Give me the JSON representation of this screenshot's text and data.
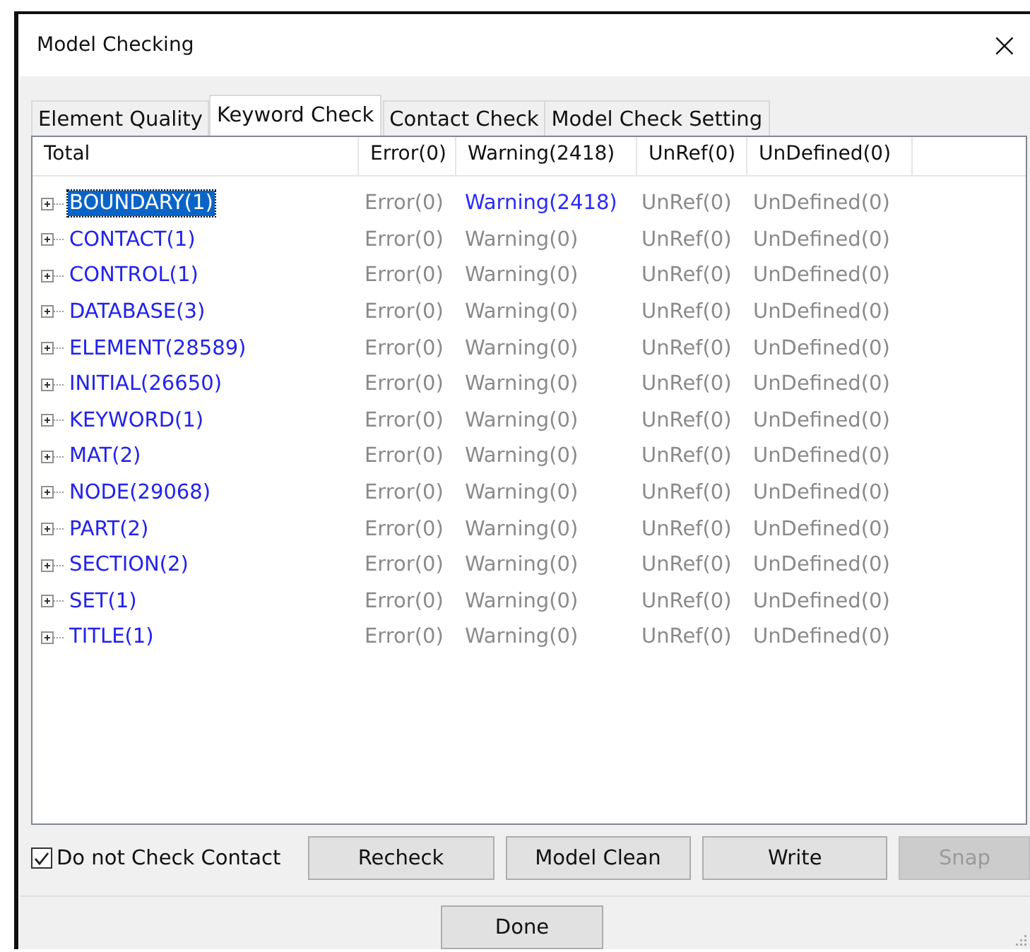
{
  "window": {
    "title": "Model Checking",
    "close": "×"
  },
  "tabs": [
    {
      "label": "Element Quality",
      "selected": false
    },
    {
      "label": "Keyword Check",
      "selected": true
    },
    {
      "label": "Contact Check",
      "selected": false
    },
    {
      "label": "Model Check Setting",
      "selected": false
    }
  ],
  "table": {
    "columns": [
      "Total",
      "Error(0)",
      "Warning(2418)",
      "UnRef(0)",
      "UnDefined(0)"
    ],
    "rows": [
      {
        "name": "BOUNDARY(1)",
        "selected": true,
        "expanded": false,
        "error": "Error(0)",
        "warning": "Warning(2418)",
        "warning_flagged": true,
        "unref": "UnRef(0)",
        "undefined": "UnDefined(0)"
      },
      {
        "name": "CONTACT(1)",
        "selected": false,
        "expanded": false,
        "error": "Error(0)",
        "warning": "Warning(0)",
        "warning_flagged": false,
        "unref": "UnRef(0)",
        "undefined": "UnDefined(0)"
      },
      {
        "name": "CONTROL(1)",
        "selected": false,
        "expanded": false,
        "error": "Error(0)",
        "warning": "Warning(0)",
        "warning_flagged": false,
        "unref": "UnRef(0)",
        "undefined": "UnDefined(0)"
      },
      {
        "name": "DATABASE(3)",
        "selected": false,
        "expanded": false,
        "error": "Error(0)",
        "warning": "Warning(0)",
        "warning_flagged": false,
        "unref": "UnRef(0)",
        "undefined": "UnDefined(0)"
      },
      {
        "name": "ELEMENT(28589)",
        "selected": false,
        "expanded": false,
        "error": "Error(0)",
        "warning": "Warning(0)",
        "warning_flagged": false,
        "unref": "UnRef(0)",
        "undefined": "UnDefined(0)"
      },
      {
        "name": "INITIAL(26650)",
        "selected": false,
        "expanded": false,
        "error": "Error(0)",
        "warning": "Warning(0)",
        "warning_flagged": false,
        "unref": "UnRef(0)",
        "undefined": "UnDefined(0)"
      },
      {
        "name": "KEYWORD(1)",
        "selected": false,
        "expanded": false,
        "error": "Error(0)",
        "warning": "Warning(0)",
        "warning_flagged": false,
        "unref": "UnRef(0)",
        "undefined": "UnDefined(0)"
      },
      {
        "name": "MAT(2)",
        "selected": false,
        "expanded": false,
        "error": "Error(0)",
        "warning": "Warning(0)",
        "warning_flagged": false,
        "unref": "UnRef(0)",
        "undefined": "UnDefined(0)"
      },
      {
        "name": "NODE(29068)",
        "selected": false,
        "expanded": false,
        "error": "Error(0)",
        "warning": "Warning(0)",
        "warning_flagged": false,
        "unref": "UnRef(0)",
        "undefined": "UnDefined(0)"
      },
      {
        "name": "PART(2)",
        "selected": false,
        "expanded": false,
        "error": "Error(0)",
        "warning": "Warning(0)",
        "warning_flagged": false,
        "unref": "UnRef(0)",
        "undefined": "UnDefined(0)"
      },
      {
        "name": "SECTION(2)",
        "selected": false,
        "expanded": false,
        "error": "Error(0)",
        "warning": "Warning(0)",
        "warning_flagged": false,
        "unref": "UnRef(0)",
        "undefined": "UnDefined(0)"
      },
      {
        "name": "SET(1)",
        "selected": false,
        "expanded": false,
        "error": "Error(0)",
        "warning": "Warning(0)",
        "warning_flagged": false,
        "unref": "UnRef(0)",
        "undefined": "UnDefined(0)"
      },
      {
        "name": "TITLE(1)",
        "selected": false,
        "expanded": false,
        "error": "Error(0)",
        "warning": "Warning(0)",
        "warning_flagged": false,
        "unref": "UnRef(0)",
        "undefined": "UnDefined(0)"
      }
    ]
  },
  "options": {
    "label": "Do not Check Contact",
    "checked": true
  },
  "buttons": [
    {
      "label": "Recheck",
      "disabled": false
    },
    {
      "label": "Model Clean",
      "disabled": false
    },
    {
      "label": "Write",
      "disabled": false
    },
    {
      "label": "Snap",
      "disabled": true
    }
  ],
  "done_button": "Done"
}
